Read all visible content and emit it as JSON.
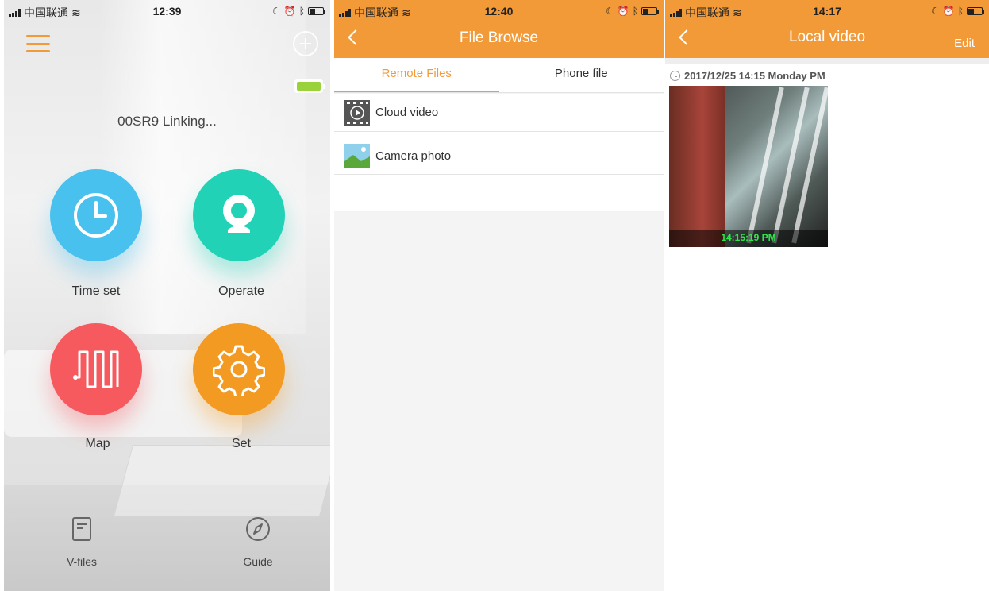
{
  "screen1": {
    "status": {
      "carrier": "中国联通",
      "time": "12:39"
    },
    "device_status": "00SR9 Linking...",
    "device_battery": 1.0,
    "buttons": {
      "time_set": "Time set",
      "operate": "Operate",
      "map": "Map",
      "set": "Set"
    },
    "bottom_tabs": {
      "vfiles": "V-files",
      "guide": "Guide"
    },
    "colors": {
      "accent": "#f29a38",
      "time_set": "#49c1ee",
      "operate": "#22d2b6",
      "map": "#f65a5e",
      "set": "#f39a22"
    }
  },
  "screen2": {
    "status": {
      "carrier": "中国联通",
      "time": "12:40"
    },
    "title": "File Browse",
    "tabs": {
      "remote": "Remote Files",
      "phone": "Phone file"
    },
    "rows": {
      "cloud": "Cloud video",
      "photo": "Camera photo"
    }
  },
  "screen3": {
    "status": {
      "carrier": "中国联通",
      "time": "14:17"
    },
    "title": "Local video",
    "edit_label": "Edit",
    "date_label": "2017/12/25 14:15 Monday PM",
    "thumbnail_timestamp": "14:15:19 PM"
  }
}
